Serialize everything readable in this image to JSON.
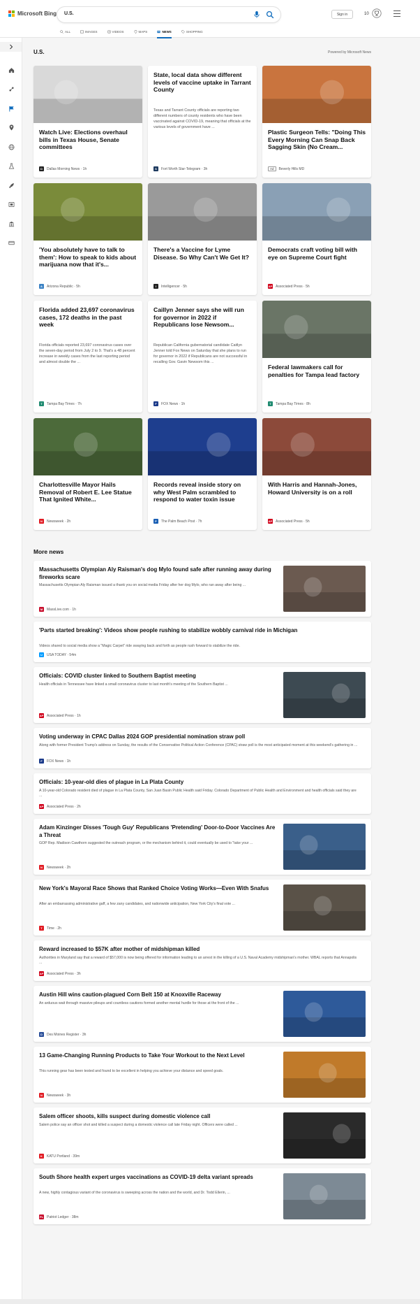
{
  "header": {
    "logo_text": "Microsoft Bing",
    "search_value": "U.S.",
    "signin_label": "Sign in",
    "rewards_count": "10",
    "logo_colors": [
      "#f25022",
      "#7fba00",
      "#00a4ef",
      "#ffb900"
    ]
  },
  "tabs": [
    {
      "label": "ALL",
      "icon": "search-icon"
    },
    {
      "label": "IMAGES",
      "icon": "image-icon"
    },
    {
      "label": "VIDEOS",
      "icon": "video-icon"
    },
    {
      "label": "MAPS",
      "icon": "map-pin-icon"
    },
    {
      "label": "NEWS",
      "icon": "news-icon",
      "active": true
    },
    {
      "label": "SHOPPING",
      "icon": "shopping-tag-icon"
    }
  ],
  "rail_icons": [
    "collapse-arrow-icon",
    "home-icon",
    "sports-icon",
    "flag-icon",
    "location-pin-icon",
    "globe-icon",
    "science-icon",
    "rocket-icon",
    "entertainment-icon",
    "bank-icon",
    "money-icon"
  ],
  "section": {
    "title": "U.S.",
    "powered_by": "Powered by Microsoft News"
  },
  "cards": [
    {
      "title": "Watch Live: Elections overhaul bills in Texas House, Senate committees",
      "source": "Dallas Morning News",
      "time": "1h",
      "badge": "D",
      "badge_color": "#222222",
      "image": true,
      "img_color": "#d9d9d9"
    },
    {
      "title": "State, local data show different levels of vaccine uptake in Tarrant County",
      "snippet": "Texas and Tarrant County officials are reporting two different numbers of county residents who have been vaccinated against COVID-19, meaning that officials at the various levels of government have ...",
      "source": "Fort Worth Star-Telegram",
      "time": "3h",
      "badge": "S",
      "badge_color": "#1e3a5f",
      "image": false
    },
    {
      "title": "Plastic Surgeon Tells: \"Doing This Every Morning Can Snap Back Sagging Skin (No Cream...",
      "source": "Beverly Hills MD",
      "time": "",
      "ad_label": "Ad",
      "image": true,
      "img_color": "#c9743e"
    },
    {
      "title": "'You absolutely have to talk to them': How to speak to kids about marijuana now that it's...",
      "source": "Arizona Republic",
      "time": "5h",
      "badge": "A",
      "badge_color": "#3b82c4",
      "image": true,
      "img_color": "#7a8b3a"
    },
    {
      "title": "There's a Vaccine for Lyme Disease. So Why Can't We Get It?",
      "source": "Intelligencer",
      "time": "5h",
      "badge": "I",
      "badge_color": "#222222",
      "image": true,
      "img_color": "#9a9a9a"
    },
    {
      "title": "Democrats craft voting bill with eye on Supreme Court fight",
      "source": "Associated Press",
      "time": "5h",
      "badge": "AP",
      "badge_color": "#d0021b",
      "image": true,
      "img_color": "#8aa0b5"
    },
    {
      "title": "Florida added 23,697 coronavirus cases, 172 deaths in the past week",
      "snippet": "Florida officials reported 23,697 coronavirus cases over the seven-day period from July 2 to 9. That's a 48 percent increase in weekly cases from the last reporting period and almost double the ...",
      "source": "Tampa Bay Times",
      "time": "7h",
      "badge": "T",
      "badge_color": "#1f8a70",
      "image": false
    },
    {
      "title": "Caillyn Jenner says she will run for governor in 2022 if Republicans lose Newsom...",
      "snippet": "Republican California gubernatorial candidate Caitlyn Jenner told Fox News on Saturday that she plans to run for governor in 2022 if Republicans are not successful in recalling Gov. Gavin Newsom this ...",
      "source": "FOX News",
      "time": "1h",
      "badge": "F",
      "badge_color": "#1b3a8a",
      "image": false
    },
    {
      "title": "Federal lawmakers call for penalties for Tampa lead factory",
      "source": "Tampa Bay Times",
      "time": "8h",
      "badge": "T",
      "badge_color": "#1f8a70",
      "image": true,
      "img_color": "#6a7566"
    },
    {
      "title": "Charlottesville Mayor Hails Removal of Robert E. Lee Statue That Ignited White...",
      "source": "Newsweek",
      "time": "2h",
      "badge": "N",
      "badge_color": "#e01a22",
      "image": true,
      "img_color": "#4c6a3a"
    },
    {
      "title": "Records reveal inside story on why West Palm scrambled to respond to water toxin issue",
      "source": "The Palm Beach Post",
      "time": "7h",
      "badge": "P",
      "badge_color": "#1a5fb4",
      "image": true,
      "img_color": "#1e3e8e"
    },
    {
      "title": "With Harris and Hannah-Jones, Howard University is on a roll",
      "source": "Associated Press",
      "time": "5h",
      "badge": "AP",
      "badge_color": "#d0021b",
      "image": true,
      "img_color": "#8c4a3a"
    }
  ],
  "more_news": {
    "title": "More news",
    "items": [
      {
        "title": "Massachusetts Olympian Aly Raisman's dog Mylo found safe after running away during fireworks scare",
        "snippet": "Massachusetts Olympian Aly Raisman issued a thank you on social media Friday after her dog Mylo, who ran away after being ...",
        "source": "MassLive.com",
        "time": "1h",
        "badge": "M",
        "badge_color": "#c8102e",
        "thumb": true,
        "thumb_color": "#6b5a50"
      },
      {
        "title": "'Parts started breaking': Videos show people rushing to stabilize wobbly carnival ride in Michigan",
        "snippet": "Videos shared to social media show a \"Magic Carpet\" ride swaying back and forth as people rush forward to stabilize the ride.",
        "source": "USA TODAY",
        "time": "54m",
        "badge": "U",
        "badge_color": "#009bff",
        "thumb": false
      },
      {
        "title": "Officials: COVID cluster linked to Southern Baptist meeting",
        "snippet": "Health officials in Tennessee have linked a small coronavirus cluster to last month's meeting of the Southern Baptist ...",
        "source": "Associated Press",
        "time": "1h",
        "badge": "AP",
        "badge_color": "#d0021b",
        "thumb": true,
        "thumb_color": "#3d4a52"
      },
      {
        "title": "Voting underway in CPAC Dallas 2024 GOP presidential nomination straw poll",
        "snippet": "Along with former President Trump's address on Sunday, the results of the Conservative Political Action Conference (CPAC) straw poll is the most anticipated moment at this weekend's gathering in ...",
        "source": "FOX News",
        "time": "1h",
        "badge": "F",
        "badge_color": "#1b3a8a",
        "thumb": false
      },
      {
        "title": "Officials: 10-year-old dies of plague in La Plata County",
        "snippet": "A 10-year-old Colorado resident died of plague in La Plata County, San Juan Basin Public Health said Friday. Colorado Department of Public Health and Environment and health officials said they are ...",
        "source": "Associated Press",
        "time": "2h",
        "badge": "AP",
        "badge_color": "#d0021b",
        "thumb": false
      },
      {
        "title": "Adam Kinzinger Disses 'Tough Guy' Republicans 'Pretending' Door-to-Door Vaccines Are a Threat",
        "snippet": "GOP Rep. Madison Cawthorn suggested the outreach program, or the mechanism behind it, could eventually be used to \"take your ...",
        "source": "Newsweek",
        "time": "2h",
        "badge": "N",
        "badge_color": "#e01a22",
        "thumb": true,
        "thumb_color": "#3a5f8a"
      },
      {
        "title": "New York's Mayoral Race Shows that Ranked Choice Voting Works—Even With Snafus",
        "snippet": "After an embarrassing administrative gaff, a few zany candidates, and nationwide anticipation, New York City's final vote ...",
        "source": "Time",
        "time": "2h",
        "badge": "T",
        "badge_color": "#e01a22",
        "thumb": true,
        "thumb_color": "#5a5248"
      },
      {
        "title": "Reward increased to $57K after mother of midshipman killed",
        "snippet": "Authorities in Maryland say that a reward of $57,000 is now being offered for information leading to an arrest in the killing of a U.S. Naval Academy midshipman's mother. WBAL reports that Annapolis ...",
        "source": "Associated Press",
        "time": "3h",
        "badge": "AP",
        "badge_color": "#d0021b",
        "thumb": false
      },
      {
        "title": "Austin Hill wins caution-plagued Corn Belt 150 at Knoxville Raceway",
        "snippet": "An arduous wait through massive pileups and countless cautions formed another mental hurdle for those at the front of the ...",
        "source": "Des Moines Register",
        "time": "3h",
        "badge": "D",
        "badge_color": "#2a4f9a",
        "thumb": true,
        "thumb_color": "#2e5a9a"
      },
      {
        "title": "13 Game-Changing Running Products to Take Your Workout to the Next Level",
        "snippet": "This running gear has been tested and found to be excellent in helping you achieve your distance and speed goals.",
        "source": "Newsweek",
        "time": "3h",
        "badge": "N",
        "badge_color": "#e01a22",
        "thumb": true,
        "thumb_color": "#c07a2a"
      },
      {
        "title": "Salem officer shoots, kills suspect during domestic violence call",
        "snippet": "Salem police say an officer shot and killed a suspect during a domestic violence call late Friday night. Officers were called ...",
        "source": "KATU Portland",
        "time": "39m",
        "badge": "K",
        "badge_color": "#e01a22",
        "thumb": true,
        "thumb_color": "#2a2a2a"
      },
      {
        "title": "South Shore health expert urges vaccinations as COVID-19 delta variant spreads",
        "snippet": "A new, highly contagious variant of the coronavirus is sweeping across the nation and the world, and Dr. Todd Ellerin, ...",
        "source": "Patriot Ledger",
        "time": "38m",
        "badge": "PL",
        "badge_color": "#c8102e",
        "thumb": true,
        "thumb_color": "#7d8a95"
      }
    ]
  }
}
